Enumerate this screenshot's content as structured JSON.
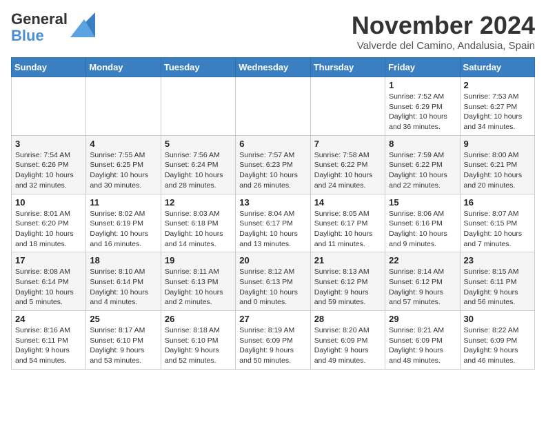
{
  "header": {
    "logo_line1": "General",
    "logo_line2": "Blue",
    "month": "November 2024",
    "location": "Valverde del Camino, Andalusia, Spain"
  },
  "weekdays": [
    "Sunday",
    "Monday",
    "Tuesday",
    "Wednesday",
    "Thursday",
    "Friday",
    "Saturday"
  ],
  "weeks": [
    [
      {
        "day": "",
        "info": ""
      },
      {
        "day": "",
        "info": ""
      },
      {
        "day": "",
        "info": ""
      },
      {
        "day": "",
        "info": ""
      },
      {
        "day": "",
        "info": ""
      },
      {
        "day": "1",
        "info": "Sunrise: 7:52 AM\nSunset: 6:29 PM\nDaylight: 10 hours and 36 minutes."
      },
      {
        "day": "2",
        "info": "Sunrise: 7:53 AM\nSunset: 6:27 PM\nDaylight: 10 hours and 34 minutes."
      }
    ],
    [
      {
        "day": "3",
        "info": "Sunrise: 7:54 AM\nSunset: 6:26 PM\nDaylight: 10 hours and 32 minutes."
      },
      {
        "day": "4",
        "info": "Sunrise: 7:55 AM\nSunset: 6:25 PM\nDaylight: 10 hours and 30 minutes."
      },
      {
        "day": "5",
        "info": "Sunrise: 7:56 AM\nSunset: 6:24 PM\nDaylight: 10 hours and 28 minutes."
      },
      {
        "day": "6",
        "info": "Sunrise: 7:57 AM\nSunset: 6:23 PM\nDaylight: 10 hours and 26 minutes."
      },
      {
        "day": "7",
        "info": "Sunrise: 7:58 AM\nSunset: 6:22 PM\nDaylight: 10 hours and 24 minutes."
      },
      {
        "day": "8",
        "info": "Sunrise: 7:59 AM\nSunset: 6:22 PM\nDaylight: 10 hours and 22 minutes."
      },
      {
        "day": "9",
        "info": "Sunrise: 8:00 AM\nSunset: 6:21 PM\nDaylight: 10 hours and 20 minutes."
      }
    ],
    [
      {
        "day": "10",
        "info": "Sunrise: 8:01 AM\nSunset: 6:20 PM\nDaylight: 10 hours and 18 minutes."
      },
      {
        "day": "11",
        "info": "Sunrise: 8:02 AM\nSunset: 6:19 PM\nDaylight: 10 hours and 16 minutes."
      },
      {
        "day": "12",
        "info": "Sunrise: 8:03 AM\nSunset: 6:18 PM\nDaylight: 10 hours and 14 minutes."
      },
      {
        "day": "13",
        "info": "Sunrise: 8:04 AM\nSunset: 6:17 PM\nDaylight: 10 hours and 13 minutes."
      },
      {
        "day": "14",
        "info": "Sunrise: 8:05 AM\nSunset: 6:17 PM\nDaylight: 10 hours and 11 minutes."
      },
      {
        "day": "15",
        "info": "Sunrise: 8:06 AM\nSunset: 6:16 PM\nDaylight: 10 hours and 9 minutes."
      },
      {
        "day": "16",
        "info": "Sunrise: 8:07 AM\nSunset: 6:15 PM\nDaylight: 10 hours and 7 minutes."
      }
    ],
    [
      {
        "day": "17",
        "info": "Sunrise: 8:08 AM\nSunset: 6:14 PM\nDaylight: 10 hours and 5 minutes."
      },
      {
        "day": "18",
        "info": "Sunrise: 8:10 AM\nSunset: 6:14 PM\nDaylight: 10 hours and 4 minutes."
      },
      {
        "day": "19",
        "info": "Sunrise: 8:11 AM\nSunset: 6:13 PM\nDaylight: 10 hours and 2 minutes."
      },
      {
        "day": "20",
        "info": "Sunrise: 8:12 AM\nSunset: 6:13 PM\nDaylight: 10 hours and 0 minutes."
      },
      {
        "day": "21",
        "info": "Sunrise: 8:13 AM\nSunset: 6:12 PM\nDaylight: 9 hours and 59 minutes."
      },
      {
        "day": "22",
        "info": "Sunrise: 8:14 AM\nSunset: 6:12 PM\nDaylight: 9 hours and 57 minutes."
      },
      {
        "day": "23",
        "info": "Sunrise: 8:15 AM\nSunset: 6:11 PM\nDaylight: 9 hours and 56 minutes."
      }
    ],
    [
      {
        "day": "24",
        "info": "Sunrise: 8:16 AM\nSunset: 6:11 PM\nDaylight: 9 hours and 54 minutes."
      },
      {
        "day": "25",
        "info": "Sunrise: 8:17 AM\nSunset: 6:10 PM\nDaylight: 9 hours and 53 minutes."
      },
      {
        "day": "26",
        "info": "Sunrise: 8:18 AM\nSunset: 6:10 PM\nDaylight: 9 hours and 52 minutes."
      },
      {
        "day": "27",
        "info": "Sunrise: 8:19 AM\nSunset: 6:09 PM\nDaylight: 9 hours and 50 minutes."
      },
      {
        "day": "28",
        "info": "Sunrise: 8:20 AM\nSunset: 6:09 PM\nDaylight: 9 hours and 49 minutes."
      },
      {
        "day": "29",
        "info": "Sunrise: 8:21 AM\nSunset: 6:09 PM\nDaylight: 9 hours and 48 minutes."
      },
      {
        "day": "30",
        "info": "Sunrise: 8:22 AM\nSunset: 6:09 PM\nDaylight: 9 hours and 46 minutes."
      }
    ]
  ]
}
